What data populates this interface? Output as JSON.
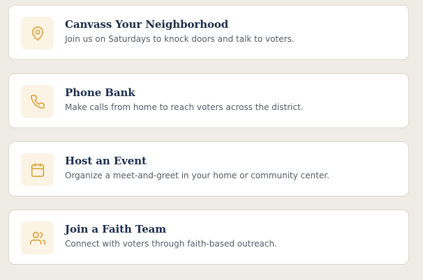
{
  "accent_color": "#d9a43b",
  "icon_bg_color": "#fbf3e4",
  "title_color": "#1c2d4a",
  "cards": [
    {
      "icon": "map-pin-icon",
      "title": "Canvass Your Neighborhood",
      "description": "Join us on Saturdays to knock doors and talk to voters."
    },
    {
      "icon": "phone-icon",
      "title": "Phone Bank",
      "description": "Make calls from home to reach voters across the district."
    },
    {
      "icon": "calendar-icon",
      "title": "Host an Event",
      "description": "Organize a meet-and-greet in your home or community center."
    },
    {
      "icon": "users-icon",
      "title": "Join a Faith Team",
      "description": "Connect with voters through faith-based outreach."
    }
  ]
}
